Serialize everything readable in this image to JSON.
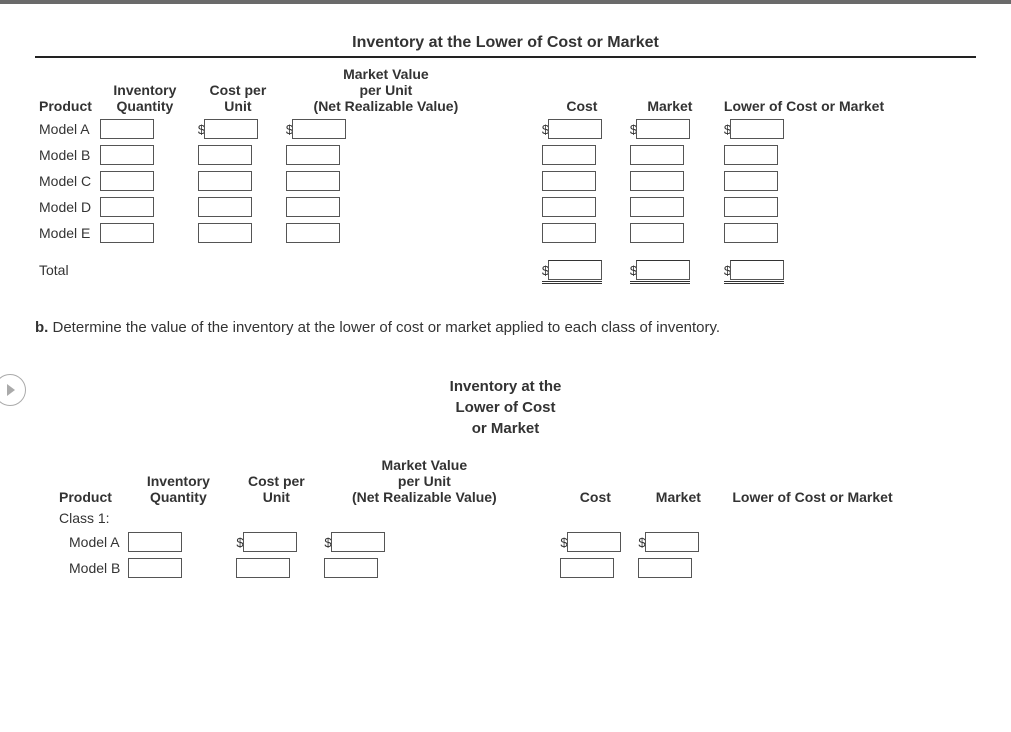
{
  "title1": "Inventory at the Lower of Cost or Market",
  "headers": {
    "product": "Product",
    "qty": "Inventory Quantity",
    "cpu": "Cost per Unit",
    "mvpu_l1": "Market Value",
    "mvpu_l2": "per Unit",
    "mvpu_l3": "(Net Realizable Value)",
    "cost": "Cost",
    "market": "Market",
    "lcm": "Lower of Cost or Market"
  },
  "t1": {
    "rows": [
      {
        "label": "Model A",
        "d": [
          true,
          true,
          true,
          true,
          true
        ]
      },
      {
        "label": "Model B",
        "d": [
          false,
          false,
          false,
          false,
          false
        ]
      },
      {
        "label": "Model C",
        "d": [
          false,
          false,
          false,
          false,
          false
        ]
      },
      {
        "label": "Model D",
        "d": [
          false,
          false,
          false,
          false,
          false
        ]
      },
      {
        "label": "Model E",
        "d": [
          false,
          false,
          false,
          false,
          false
        ]
      }
    ],
    "total_label": "Total"
  },
  "part_b": "b.",
  "part_b_text": " Determine the value of the inventory at the lower of cost or market applied to each class of inventory.",
  "title2_l1": "Inventory at the",
  "title2_l2": "Lower of Cost",
  "title2_l3": "or Market",
  "t2": {
    "class1": "Class 1:",
    "rows": [
      {
        "label": "Model A",
        "d": [
          true,
          true,
          true,
          true
        ]
      },
      {
        "label": "Model B",
        "d": [
          false,
          false,
          false,
          false
        ]
      }
    ]
  }
}
